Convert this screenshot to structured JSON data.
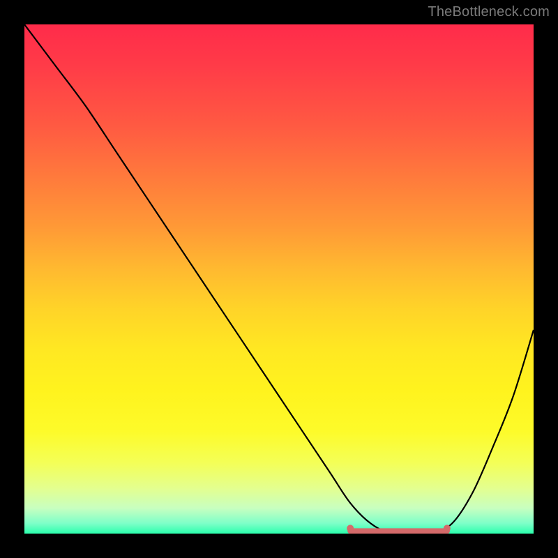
{
  "watermark": "TheBottleneck.com",
  "colors": {
    "curve": "#000000",
    "optimal_segment": "#d46a6a",
    "gradient_top": "#ff2b4a",
    "gradient_bottom": "#2bffad",
    "frame": "#000000"
  },
  "chart_data": {
    "type": "line",
    "title": "",
    "xlabel": "",
    "ylabel": "",
    "xlim": [
      0,
      100
    ],
    "ylim": [
      0,
      100
    ],
    "grid": false,
    "legend": false,
    "series": [
      {
        "name": "bottleneck-curve",
        "x": [
          0,
          6,
          12,
          18,
          24,
          30,
          36,
          42,
          48,
          54,
          60,
          64,
          68,
          72,
          76,
          80,
          84,
          88,
          92,
          96,
          100
        ],
        "y": [
          100,
          92,
          84,
          75,
          66,
          57,
          48,
          39,
          30,
          21,
          12,
          6,
          2,
          0,
          0,
          0,
          2,
          8,
          17,
          27,
          40
        ]
      }
    ],
    "optimal_range": {
      "x_start": 64,
      "x_end": 83,
      "y": 0.5
    },
    "annotations": []
  }
}
